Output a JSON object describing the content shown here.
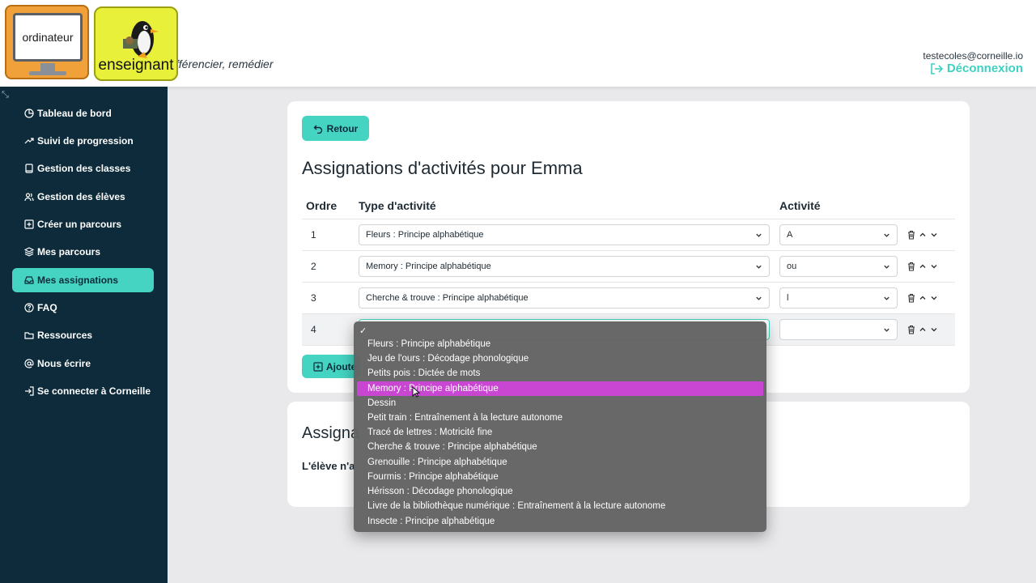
{
  "header": {
    "tagline": "différencier, remédier",
    "user_email": "testecoles@corneille.io",
    "logout_label": "Déconnexion"
  },
  "badges": {
    "computer_label": "ordinateur",
    "teacher_label": "enseignant"
  },
  "colors": {
    "sidebar_bg": "#0d2b3a",
    "accent": "#45d4c2",
    "dropdown_highlight": "#c846d2"
  },
  "sidebar": {
    "items": [
      {
        "label": "Tableau de bord",
        "icon": "pie-chart-icon"
      },
      {
        "label": "Suivi de progression",
        "icon": "trending-up-icon"
      },
      {
        "label": "Gestion des classes",
        "icon": "book-icon"
      },
      {
        "label": "Gestion des élèves",
        "icon": "users-icon"
      },
      {
        "label": "Créer un parcours",
        "icon": "plus-square-icon"
      },
      {
        "label": "Mes parcours",
        "icon": "layers-icon"
      },
      {
        "label": "Mes assignations",
        "icon": "inbox-icon",
        "active": true
      },
      {
        "label": "FAQ",
        "icon": "help-circle-icon"
      },
      {
        "label": "Ressources",
        "icon": "folder-icon"
      },
      {
        "label": "Nous écrire",
        "icon": "at-sign-icon"
      },
      {
        "label": "Se connecter à Corneille",
        "icon": "log-in-icon"
      }
    ]
  },
  "main": {
    "back_label": "Retour",
    "title": "Assignations d'activités pour Emma",
    "columns": {
      "order": "Ordre",
      "type": "Type d'activité",
      "activity": "Activité"
    },
    "rows": [
      {
        "order": "1",
        "type": "Fleurs : Principe alphabétique",
        "activity": "A"
      },
      {
        "order": "2",
        "type": "Memory : Principe alphabétique",
        "activity": "ou"
      },
      {
        "order": "3",
        "type": "Cherche & trouve : Principe alphabétique",
        "activity": "l"
      },
      {
        "order": "4",
        "type": "",
        "activity": ""
      }
    ],
    "add_label": "Ajoute"
  },
  "card2": {
    "title": "Assigna",
    "text": "L'élève n'a"
  },
  "dropdown": {
    "check": "✓",
    "selected_index": 3,
    "options": [
      "Fleurs : Principe alphabétique",
      "Jeu de l'ours : Décodage phonologique",
      "Petits pois : Dictée de mots",
      "Memory : Principe alphabétique",
      "Dessin",
      "Petit train : Entraînement à la lecture autonome",
      "Tracé de lettres : Motricité fine",
      "Cherche & trouve : Principe alphabétique",
      "Grenouille : Principe alphabétique",
      "Fourmis : Principe alphabétique",
      "Hérisson : Décodage phonologique",
      "Livre de la bibliothèque numérique : Entraînement à la lecture autonome",
      "Insecte : Principe alphabétique"
    ]
  }
}
